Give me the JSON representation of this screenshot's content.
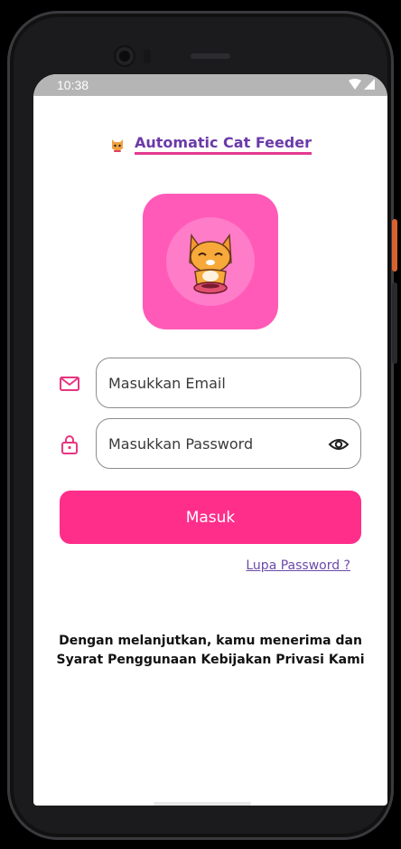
{
  "status_bar": {
    "time": "10:38"
  },
  "app": {
    "title": "Automatic Cat Feeder",
    "logo_emoji": "🐱"
  },
  "form": {
    "email_placeholder": "Masukkan Email",
    "password_placeholder": "Masukkan Password",
    "login_label": "Masuk",
    "forgot_label": "Lupa Password ?"
  },
  "footer": {
    "line1": "Dengan melanjutkan, kamu menerima dan",
    "line2": "Syarat Penggunaan Kebijakan Privasi Kami"
  },
  "colors": {
    "accent": "#ff2e8a",
    "logo_bg": "#ff5ab8",
    "brand_text": "#6b3aa8",
    "underline": "#e23a90"
  }
}
